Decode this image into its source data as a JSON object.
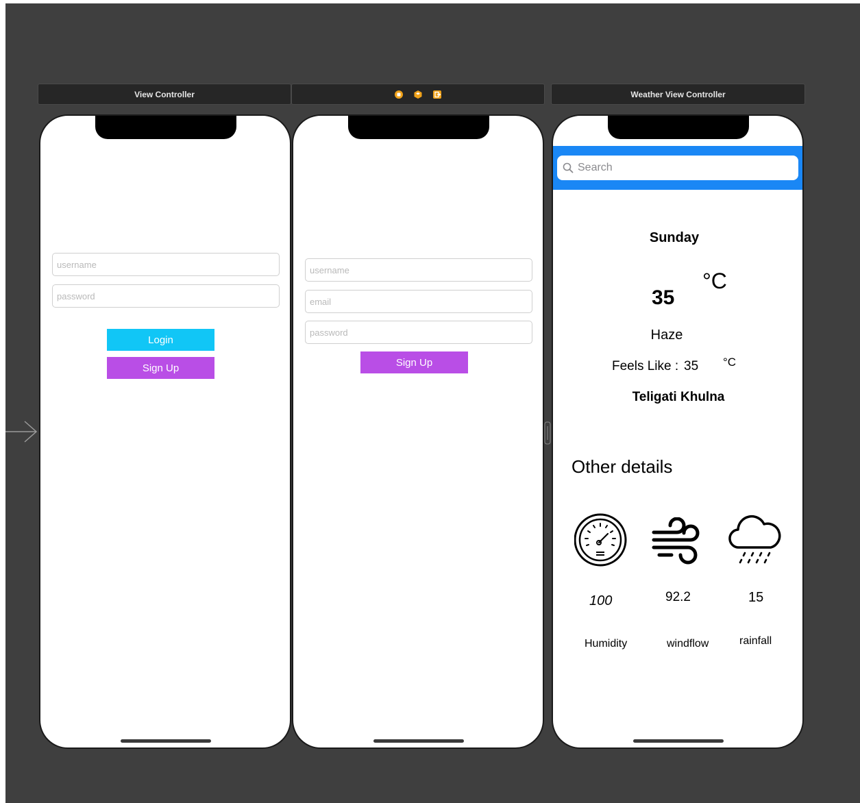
{
  "scenes": [
    {
      "title": "View Controller"
    },
    {
      "title": ""
    },
    {
      "title": "Weather View Controller"
    }
  ],
  "scene_bar_icons": [
    "scene-dock-icon",
    "first-responder-icon",
    "exit-icon"
  ],
  "colors": {
    "canvas": "#3f3f3f",
    "login_button": "#11c6f6",
    "signup_button": "#b94ee6",
    "search_band": "#1a87f5"
  },
  "login": {
    "username_placeholder": "username",
    "password_placeholder": "password",
    "login_label": "Login",
    "signup_label": "Sign Up"
  },
  "signup": {
    "username_placeholder": "username",
    "email_placeholder": "email",
    "password_placeholder": "password",
    "signup_label": "Sign Up"
  },
  "weather": {
    "search_placeholder": "Search",
    "day": "Sunday",
    "temperature": "35",
    "temp_unit": "°C",
    "condition": "Haze",
    "feels_like_label": "Feels Like :",
    "feels_like_value": "35",
    "feels_like_unit": "°C",
    "location": "Teligati Khulna",
    "other_details_title": "Other details",
    "details": [
      {
        "icon": "barometer-icon",
        "value": "100",
        "label": "Humidity"
      },
      {
        "icon": "wind-icon",
        "value": "92.2",
        "label": "windflow"
      },
      {
        "icon": "rain-cloud-icon",
        "value": "15",
        "label": "rainfall"
      }
    ]
  }
}
